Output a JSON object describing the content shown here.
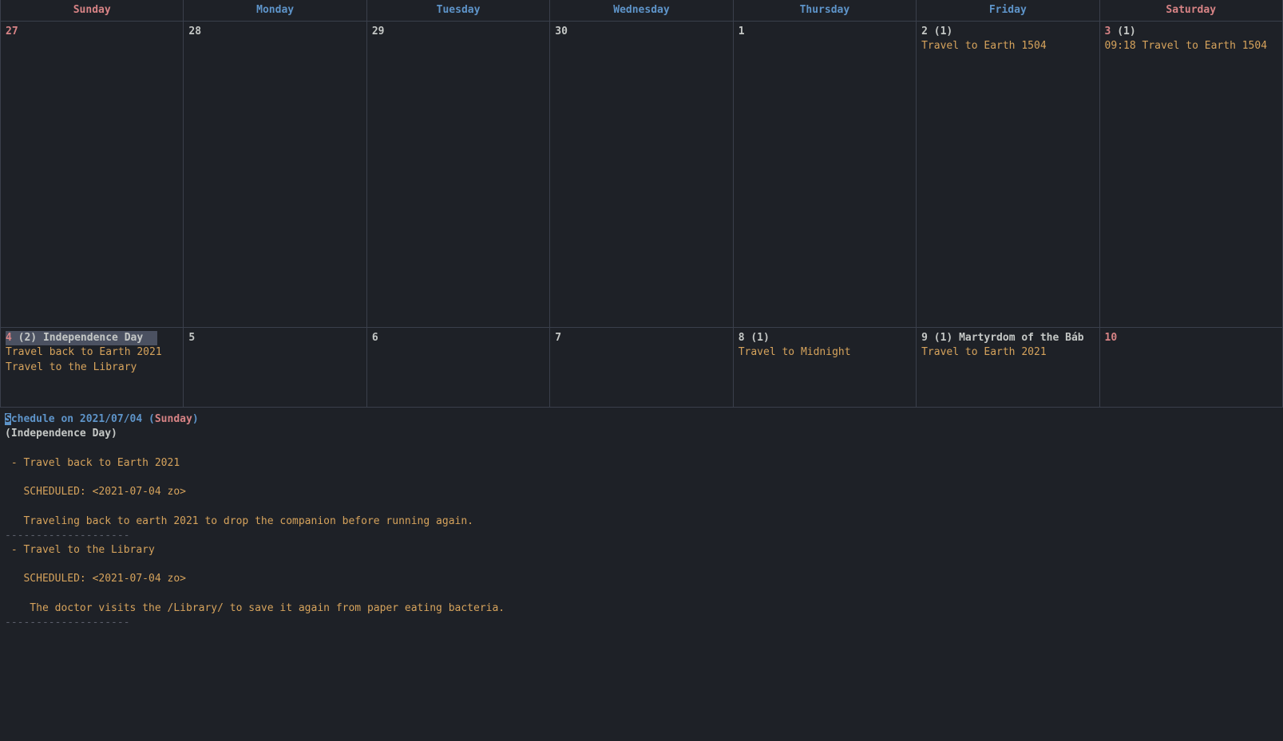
{
  "headers": [
    "Sunday",
    "Monday",
    "Tuesday",
    "Wednesday",
    "Thursday",
    "Friday",
    "Saturday"
  ],
  "weeks": [
    {
      "tall": true,
      "days": [
        {
          "num": "27",
          "weekend": true,
          "count": "",
          "holiday": "",
          "selected": false,
          "events": []
        },
        {
          "num": "28",
          "weekend": false,
          "count": "",
          "holiday": "",
          "selected": false,
          "events": []
        },
        {
          "num": "29",
          "weekend": false,
          "count": "",
          "holiday": "",
          "selected": false,
          "events": []
        },
        {
          "num": "30",
          "weekend": false,
          "count": "",
          "holiday": "",
          "selected": false,
          "events": []
        },
        {
          "num": "1",
          "weekend": false,
          "count": "",
          "holiday": "",
          "selected": false,
          "events": []
        },
        {
          "num": "2",
          "weekend": false,
          "count": "(1)",
          "holiday": "",
          "selected": false,
          "events": [
            "Travel to Earth 1504"
          ]
        },
        {
          "num": "3",
          "weekend": true,
          "count": "(1)",
          "holiday": "",
          "selected": false,
          "events": [
            "09:18 Travel to Earth 1504"
          ]
        }
      ]
    },
    {
      "tall": false,
      "days": [
        {
          "num": "4",
          "weekend": true,
          "count": "(2)",
          "holiday": "Independence Day",
          "selected": true,
          "events": [
            "Travel back to Earth 2021",
            "Travel to the Library"
          ]
        },
        {
          "num": "5",
          "weekend": false,
          "count": "",
          "holiday": "",
          "selected": false,
          "events": []
        },
        {
          "num": "6",
          "weekend": false,
          "count": "",
          "holiday": "",
          "selected": false,
          "events": []
        },
        {
          "num": "7",
          "weekend": false,
          "count": "",
          "holiday": "",
          "selected": false,
          "events": []
        },
        {
          "num": "8",
          "weekend": false,
          "count": "(1)",
          "holiday": "",
          "selected": false,
          "events": [
            "Travel to Midnight"
          ]
        },
        {
          "num": "9",
          "weekend": false,
          "count": "(1)",
          "holiday": "Martyrdom of the Báb",
          "selected": false,
          "events": [
            "Travel to Earth 2021"
          ]
        },
        {
          "num": "10",
          "weekend": true,
          "count": "",
          "holiday": "",
          "selected": false,
          "events": []
        }
      ]
    }
  ],
  "schedule": {
    "title_prefix": "Schedule on 2021/07/04 ",
    "title_cursor": "S",
    "title_rest": "chedule on 2021/07/04 ",
    "paren_open": "(",
    "dow": "Sunday",
    "paren_close": ")",
    "holiday": "(Independence Day)",
    "items": [
      {
        "bullet": " - Travel back to Earth 2021",
        "scheduled": "   SCHEDULED: <2021-07-04 zo>",
        "desc": "   Traveling back to earth 2021 to drop the companion before running again."
      },
      {
        "bullet": " - Travel to the Library",
        "scheduled": "   SCHEDULED: <2021-07-04 zo>",
        "desc": "    The doctor visits the /Library/ to save it again from paper eating bacteria."
      }
    ],
    "divider": "--------------------"
  }
}
